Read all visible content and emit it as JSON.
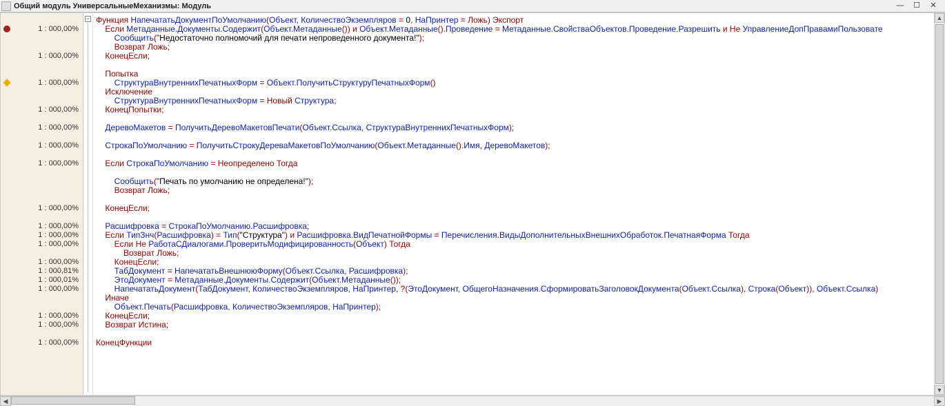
{
  "title": "Общий модуль УниверсальныеМеханизмы: Модуль",
  "gutter": [
    {
      "text": ""
    },
    {
      "text": "1 : 000,00%",
      "marker": "red"
    },
    {
      "text": ""
    },
    {
      "text": ""
    },
    {
      "text": "1 : 000,00%"
    },
    {
      "text": ""
    },
    {
      "text": ""
    },
    {
      "text": "1 : 000,00%",
      "marker": "yellow"
    },
    {
      "text": ""
    },
    {
      "text": ""
    },
    {
      "text": "1 : 000,00%"
    },
    {
      "text": ""
    },
    {
      "text": "1 : 000,00%"
    },
    {
      "text": ""
    },
    {
      "text": "1 : 000,00%"
    },
    {
      "text": ""
    },
    {
      "text": "1 : 000,00%"
    },
    {
      "text": ""
    },
    {
      "text": ""
    },
    {
      "text": ""
    },
    {
      "text": ""
    },
    {
      "text": "1 : 000,00%"
    },
    {
      "text": ""
    },
    {
      "text": "1 : 000,00%"
    },
    {
      "text": "1 : 000,00%"
    },
    {
      "text": "1 : 000,00%"
    },
    {
      "text": ""
    },
    {
      "text": "1 : 000,00%"
    },
    {
      "text": "1 : 000,81%"
    },
    {
      "text": "1 : 000,01%"
    },
    {
      "text": "1 : 000,00%"
    },
    {
      "text": ""
    },
    {
      "text": ""
    },
    {
      "text": "1 : 000,00%"
    },
    {
      "text": "1 : 000,00%"
    },
    {
      "text": ""
    },
    {
      "text": "1 : 000,00%"
    }
  ],
  "code": [
    [
      [
        "kw",
        "Функция "
      ],
      [
        "id",
        "НапечататьДокументПоУмолчанию"
      ],
      [
        "par",
        "("
      ],
      [
        "id",
        "Объект"
      ],
      [
        "pun",
        ", "
      ],
      [
        "id",
        "КоличествоЭкземпляров"
      ],
      [
        "op",
        " = "
      ],
      [
        "num",
        "0"
      ],
      [
        "pun",
        ", "
      ],
      [
        "id",
        "НаПринтер"
      ],
      [
        "op",
        " = "
      ],
      [
        "kw",
        "Ложь"
      ],
      [
        "par",
        ") "
      ],
      [
        "kw",
        "Экспорт"
      ]
    ],
    [
      [
        "plain",
        "    "
      ],
      [
        "kw",
        "Если "
      ],
      [
        "id",
        "Метаданные"
      ],
      [
        "pun",
        "."
      ],
      [
        "id",
        "Документы"
      ],
      [
        "pun",
        "."
      ],
      [
        "id",
        "Содержит"
      ],
      [
        "par",
        "("
      ],
      [
        "id",
        "Объект"
      ],
      [
        "pun",
        "."
      ],
      [
        "id",
        "Метаданные"
      ],
      [
        "par",
        "()) "
      ],
      [
        "kw",
        "и "
      ],
      [
        "id",
        "Объект"
      ],
      [
        "pun",
        "."
      ],
      [
        "id",
        "Метаданные"
      ],
      [
        "par",
        "()"
      ],
      [
        "pun",
        "."
      ],
      [
        "id",
        "Проведение"
      ],
      [
        "op",
        " = "
      ],
      [
        "id",
        "Метаданные"
      ],
      [
        "pun",
        "."
      ],
      [
        "id",
        "СвойстваОбъектов"
      ],
      [
        "pun",
        "."
      ],
      [
        "id",
        "Проведение"
      ],
      [
        "pun",
        "."
      ],
      [
        "id",
        "Разрешить"
      ],
      [
        "kw",
        " и Не "
      ],
      [
        "id",
        "УправлениеДопПравамиПользовате"
      ]
    ],
    [
      [
        "plain",
        "        "
      ],
      [
        "id",
        "Сообщить"
      ],
      [
        "par",
        "("
      ],
      [
        "str",
        "\"Недостаточно полномочий для печати непроведенного документа!\""
      ],
      [
        "par",
        ")"
      ],
      [
        "pun",
        ";"
      ]
    ],
    [
      [
        "plain",
        "        "
      ],
      [
        "kw",
        "Возврат Ложь"
      ],
      [
        "pun",
        ";"
      ]
    ],
    [
      [
        "plain",
        "    "
      ],
      [
        "kw",
        "КонецЕсли"
      ],
      [
        "pun",
        ";"
      ]
    ],
    [
      [
        "plain",
        ""
      ]
    ],
    [
      [
        "plain",
        "    "
      ],
      [
        "kw",
        "Попытка"
      ]
    ],
    [
      [
        "plain",
        "        "
      ],
      [
        "id",
        "СтруктураВнутреннихПечатныхФорм"
      ],
      [
        "op",
        " = "
      ],
      [
        "id",
        "Объект"
      ],
      [
        "pun",
        "."
      ],
      [
        "id",
        "ПолучитьСтруктуруПечатныхФорм"
      ],
      [
        "par",
        "()"
      ]
    ],
    [
      [
        "plain",
        "    "
      ],
      [
        "kw",
        "Исключение"
      ]
    ],
    [
      [
        "plain",
        "        "
      ],
      [
        "id",
        "СтруктураВнутреннихПечатныхФорм"
      ],
      [
        "op",
        " = "
      ],
      [
        "kw",
        "Новый "
      ],
      [
        "id",
        "Структура"
      ],
      [
        "pun",
        ";"
      ]
    ],
    [
      [
        "plain",
        "    "
      ],
      [
        "kw",
        "КонецПопытки"
      ],
      [
        "pun",
        ";"
      ]
    ],
    [
      [
        "plain",
        ""
      ]
    ],
    [
      [
        "plain",
        "    "
      ],
      [
        "id",
        "ДеревоМакетов"
      ],
      [
        "op",
        " = "
      ],
      [
        "id",
        "ПолучитьДеревоМакетовПечати"
      ],
      [
        "par",
        "("
      ],
      [
        "id",
        "Объект"
      ],
      [
        "pun",
        "."
      ],
      [
        "id",
        "Ссылка"
      ],
      [
        "pun",
        ", "
      ],
      [
        "id",
        "СтруктураВнутреннихПечатныхФорм"
      ],
      [
        "par",
        ")"
      ],
      [
        "pun",
        ";"
      ]
    ],
    [
      [
        "plain",
        ""
      ]
    ],
    [
      [
        "plain",
        "    "
      ],
      [
        "id",
        "СтрокаПоУмолчанию"
      ],
      [
        "op",
        " = "
      ],
      [
        "id",
        "ПолучитьСтрокуДереваМакетовПоУмолчанию"
      ],
      [
        "par",
        "("
      ],
      [
        "id",
        "Объект"
      ],
      [
        "pun",
        "."
      ],
      [
        "id",
        "Метаданные"
      ],
      [
        "par",
        "()"
      ],
      [
        "pun",
        "."
      ],
      [
        "id",
        "Имя"
      ],
      [
        "pun",
        ", "
      ],
      [
        "id",
        "ДеревоМакетов"
      ],
      [
        "par",
        ")"
      ],
      [
        "pun",
        ";"
      ]
    ],
    [
      [
        "plain",
        ""
      ]
    ],
    [
      [
        "plain",
        "    "
      ],
      [
        "kw",
        "Если "
      ],
      [
        "id",
        "СтрокаПоУмолчанию"
      ],
      [
        "op",
        " = "
      ],
      [
        "kw",
        "Неопределено Тогда"
      ]
    ],
    [
      [
        "plain",
        ""
      ]
    ],
    [
      [
        "plain",
        "        "
      ],
      [
        "id",
        "Сообщить"
      ],
      [
        "par",
        "("
      ],
      [
        "str",
        "\"Печать по умолчанию не определена!\""
      ],
      [
        "par",
        ")"
      ],
      [
        "pun",
        ";"
      ]
    ],
    [
      [
        "plain",
        "        "
      ],
      [
        "kw",
        "Возврат Ложь"
      ],
      [
        "pun",
        ";"
      ]
    ],
    [
      [
        "plain",
        ""
      ]
    ],
    [
      [
        "plain",
        "    "
      ],
      [
        "kw",
        "КонецЕсли"
      ],
      [
        "pun",
        ";"
      ]
    ],
    [
      [
        "plain",
        ""
      ]
    ],
    [
      [
        "plain",
        "    "
      ],
      [
        "id",
        "Расшифровка"
      ],
      [
        "op",
        " = "
      ],
      [
        "id",
        "СтрокаПоУмолчанию"
      ],
      [
        "pun",
        "."
      ],
      [
        "id",
        "Расшифровка"
      ],
      [
        "pun",
        ";"
      ]
    ],
    [
      [
        "plain",
        "    "
      ],
      [
        "kw",
        "Если "
      ],
      [
        "id",
        "ТипЗнч"
      ],
      [
        "par",
        "("
      ],
      [
        "id",
        "Расшифровка"
      ],
      [
        "par",
        ") "
      ],
      [
        "op",
        "= "
      ],
      [
        "id",
        "Тип"
      ],
      [
        "par",
        "("
      ],
      [
        "str",
        "\"Структура\""
      ],
      [
        "par",
        ") "
      ],
      [
        "kw",
        "и "
      ],
      [
        "id",
        "Расшифровка"
      ],
      [
        "pun",
        "."
      ],
      [
        "id",
        "ВидПечатнойФормы"
      ],
      [
        "op",
        " = "
      ],
      [
        "id",
        "Перечисления"
      ],
      [
        "pun",
        "."
      ],
      [
        "id",
        "ВидыДополнительныхВнешнихОбработок"
      ],
      [
        "pun",
        "."
      ],
      [
        "id",
        "ПечатнаяФорма"
      ],
      [
        "kw",
        " Тогда"
      ]
    ],
    [
      [
        "plain",
        "        "
      ],
      [
        "kw",
        "Если Не "
      ],
      [
        "id",
        "РаботаСДиалогами"
      ],
      [
        "pun",
        "."
      ],
      [
        "id",
        "ПроверитьМодифицированность"
      ],
      [
        "par",
        "("
      ],
      [
        "id",
        "Объект"
      ],
      [
        "par",
        ") "
      ],
      [
        "kw",
        "Тогда"
      ]
    ],
    [
      [
        "plain",
        "            "
      ],
      [
        "kw",
        "Возврат Ложь"
      ],
      [
        "pun",
        ";"
      ]
    ],
    [
      [
        "plain",
        "        "
      ],
      [
        "kw",
        "КонецЕсли"
      ],
      [
        "pun",
        ";"
      ]
    ],
    [
      [
        "plain",
        "        "
      ],
      [
        "id",
        "ТабДокумент"
      ],
      [
        "op",
        " = "
      ],
      [
        "id",
        "НапечататьВнешнююФорму"
      ],
      [
        "par",
        "("
      ],
      [
        "id",
        "Объект"
      ],
      [
        "pun",
        "."
      ],
      [
        "id",
        "Ссылка"
      ],
      [
        "pun",
        ", "
      ],
      [
        "id",
        "Расшифровка"
      ],
      [
        "par",
        ")"
      ],
      [
        "pun",
        ";"
      ]
    ],
    [
      [
        "plain",
        "        "
      ],
      [
        "id",
        "ЭтоДокумент"
      ],
      [
        "op",
        " = "
      ],
      [
        "id",
        "Метаданные"
      ],
      [
        "pun",
        "."
      ],
      [
        "id",
        "Документы"
      ],
      [
        "pun",
        "."
      ],
      [
        "id",
        "Содержит"
      ],
      [
        "par",
        "("
      ],
      [
        "id",
        "Объект"
      ],
      [
        "pun",
        "."
      ],
      [
        "id",
        "Метаданные"
      ],
      [
        "par",
        "())"
      ],
      [
        "pun",
        ";"
      ]
    ],
    [
      [
        "plain",
        "        "
      ],
      [
        "id",
        "НапечататьДокумент"
      ],
      [
        "par",
        "("
      ],
      [
        "id",
        "ТабДокумент"
      ],
      [
        "pun",
        ", "
      ],
      [
        "id",
        "КоличествоЭкземпляров"
      ],
      [
        "pun",
        ", "
      ],
      [
        "id",
        "НаПринтер"
      ],
      [
        "pun",
        ", "
      ],
      [
        "kw",
        "?"
      ],
      [
        "par",
        "("
      ],
      [
        "id",
        "ЭтоДокумент"
      ],
      [
        "pun",
        ", "
      ],
      [
        "id",
        "ОбщегоНазначения"
      ],
      [
        "pun",
        "."
      ],
      [
        "id",
        "СформироватьЗаголовокДокумента"
      ],
      [
        "par",
        "("
      ],
      [
        "id",
        "Объект"
      ],
      [
        "pun",
        "."
      ],
      [
        "id",
        "Ссылка"
      ],
      [
        "par",
        ")"
      ],
      [
        "pun",
        ", "
      ],
      [
        "id",
        "Строка"
      ],
      [
        "par",
        "("
      ],
      [
        "id",
        "Объект"
      ],
      [
        "par",
        "))"
      ],
      [
        "pun",
        ", "
      ],
      [
        "id",
        "Объект"
      ],
      [
        "pun",
        "."
      ],
      [
        "id",
        "Ссылка"
      ],
      [
        "par",
        ")"
      ]
    ],
    [
      [
        "plain",
        "    "
      ],
      [
        "kw",
        "Иначе"
      ]
    ],
    [
      [
        "plain",
        "        "
      ],
      [
        "id",
        "Объект"
      ],
      [
        "pun",
        "."
      ],
      [
        "id",
        "Печать"
      ],
      [
        "par",
        "("
      ],
      [
        "id",
        "Расшифровка"
      ],
      [
        "pun",
        ", "
      ],
      [
        "id",
        "КоличествоЭкземпляров"
      ],
      [
        "pun",
        ", "
      ],
      [
        "id",
        "НаПринтер"
      ],
      [
        "par",
        ")"
      ],
      [
        "pun",
        ";"
      ]
    ],
    [
      [
        "plain",
        "    "
      ],
      [
        "kw",
        "КонецЕсли"
      ],
      [
        "pun",
        ";"
      ]
    ],
    [
      [
        "plain",
        "    "
      ],
      [
        "kw",
        "Возврат Истина"
      ],
      [
        "pun",
        ";"
      ]
    ],
    [
      [
        "plain",
        ""
      ]
    ],
    [
      [
        "kw",
        "КонецФункции"
      ]
    ]
  ]
}
